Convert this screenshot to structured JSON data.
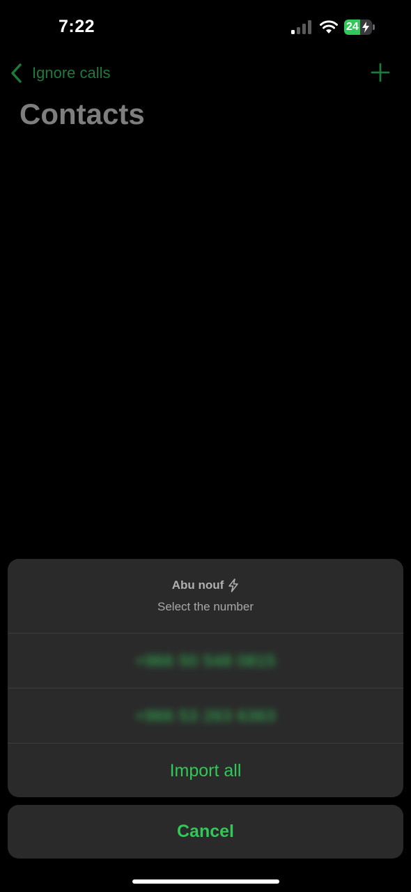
{
  "status_bar": {
    "time": "7:22",
    "battery_level": "24",
    "battery_fraction": 0.24,
    "icons": [
      "cellular-signal-icon",
      "wifi-icon",
      "battery-charging-icon"
    ]
  },
  "nav": {
    "back_label": "Ignore calls",
    "back_icon": "chevron-left-icon",
    "add_icon": "plus-icon",
    "title": "Contacts"
  },
  "sheet": {
    "contact_name": "Abu nouf",
    "contact_icon": "lightning-bolt-icon",
    "subtitle": "Select the number",
    "numbers": [
      "+966 50 548 0815",
      "+966 53 263 6363"
    ],
    "import_all_label": "Import all",
    "cancel_label": "Cancel"
  },
  "colors": {
    "accent": "#32c759",
    "dimmed_accent": "#1e7a3a",
    "sheet_background": "#2a2a2a",
    "background": "#000000"
  }
}
